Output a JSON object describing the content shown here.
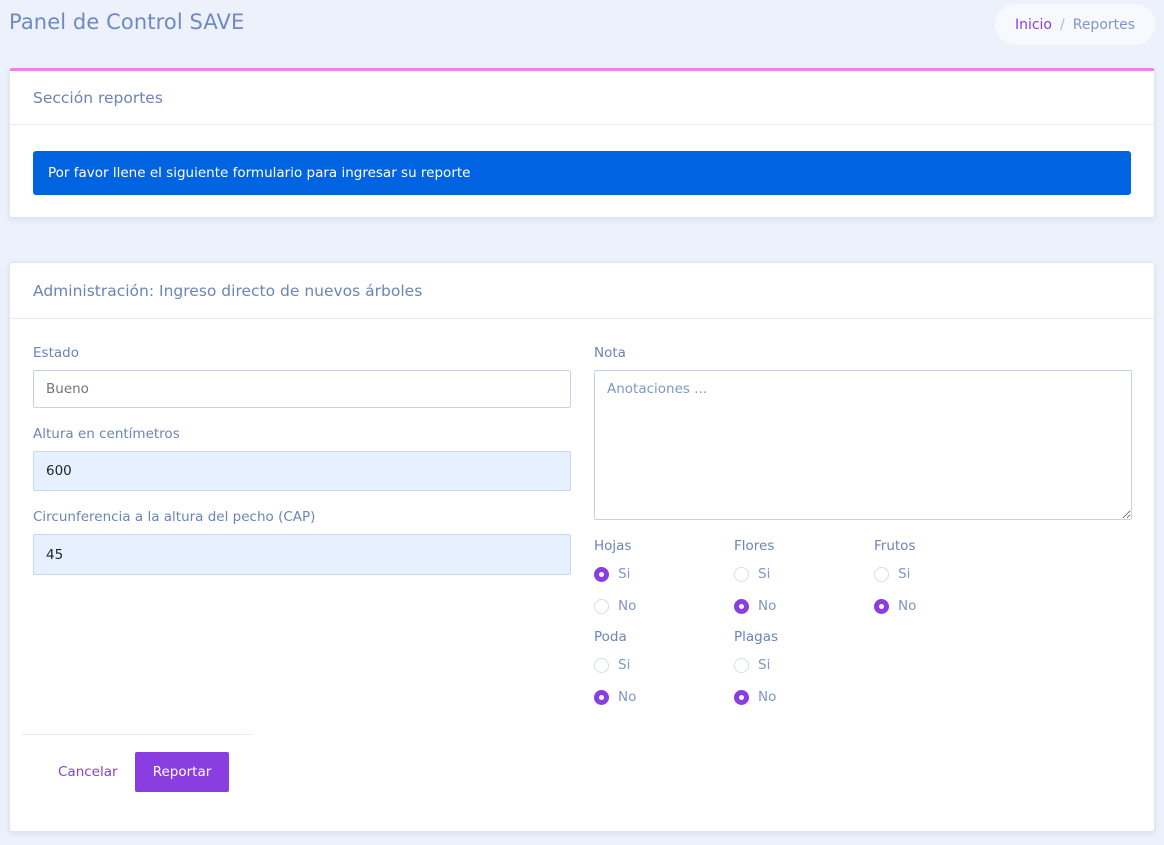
{
  "page": {
    "title": "Panel de Control SAVE"
  },
  "breadcrumb": {
    "home": "Inicio",
    "separator": "/",
    "current": "Reportes"
  },
  "section_card": {
    "title": "Sección reportes",
    "alert": "Por favor llene el siguiente formulario para ingresar su reporte"
  },
  "form_card": {
    "title": "Administración: Ingreso directo de nuevos árboles",
    "estado": {
      "label": "Estado",
      "placeholder": "Bueno",
      "value": ""
    },
    "altura": {
      "label": "Altura en centímetros",
      "value": "600"
    },
    "cap": {
      "label": "Circunferencia a la altura del pecho (CAP)",
      "value": "45"
    },
    "nota": {
      "label": "Nota",
      "placeholder": "Anotaciones ..."
    },
    "radio_groups": [
      {
        "label": "Hojas",
        "yes": "Si",
        "no": "No",
        "selected": "Si"
      },
      {
        "label": "Flores",
        "yes": "Si",
        "no": "No",
        "selected": "No"
      },
      {
        "label": "Frutos",
        "yes": "Si",
        "no": "No",
        "selected": "No"
      },
      {
        "label": "Poda",
        "yes": "Si",
        "no": "No",
        "selected": "No"
      },
      {
        "label": "Plagas",
        "yes": "Si",
        "no": "No",
        "selected": "No"
      }
    ],
    "cancel_label": "Cancelar",
    "submit_label": "Reportar"
  },
  "colors": {
    "accent": "#8a3ee0",
    "alert_bg": "#0064e0",
    "card_top_border": "#ef82e6",
    "page_bg": "#edf1fb"
  }
}
